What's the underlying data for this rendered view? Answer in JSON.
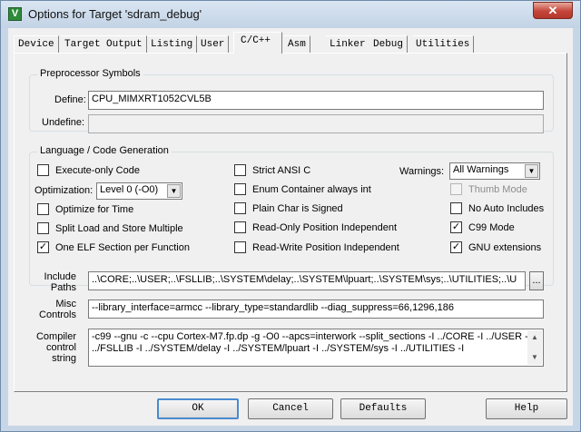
{
  "window": {
    "title": "Options for Target 'sdram_debug'",
    "close_glyph": "✕",
    "icon_letter": "V"
  },
  "tabs": [
    "Device",
    "Target",
    "Output",
    "Listing",
    "User",
    "C/C++",
    "Asm",
    "Linker",
    "Debug",
    "Utilities"
  ],
  "active_tab": "C/C++",
  "preprocessor": {
    "group_title": "Preprocessor Symbols",
    "define_label": "Define:",
    "define_value": "CPU_MIMXRT1052CVL5B",
    "undefine_label": "Undefine:",
    "undefine_value": ""
  },
  "language": {
    "group_title": "Language / Code Generation",
    "execute_only": {
      "label": "Execute-only Code",
      "checked": false
    },
    "optimization_label": "Optimization:",
    "optimization_value": "Level 0 (-O0)",
    "optimize_time": {
      "label": "Optimize for Time",
      "checked": false
    },
    "split_load": {
      "label": "Split Load and Store Multiple",
      "checked": false
    },
    "one_elf": {
      "label": "One ELF Section per Function",
      "checked": true
    },
    "strict_ansi": {
      "label": "Strict ANSI C",
      "checked": false
    },
    "enum_container": {
      "label": "Enum Container always int",
      "checked": false
    },
    "plain_char": {
      "label": "Plain Char is Signed",
      "checked": false
    },
    "ro_pi": {
      "label": "Read-Only Position Independent",
      "checked": false
    },
    "rw_pi": {
      "label": "Read-Write Position Independent",
      "checked": false
    },
    "warnings_label": "Warnings:",
    "warnings_value": "All Warnings",
    "thumb_mode": {
      "label": "Thumb Mode",
      "checked": false,
      "enabled": false
    },
    "no_auto_includes": {
      "label": "No Auto Includes",
      "checked": false
    },
    "c99_mode": {
      "label": "C99 Mode",
      "checked": true
    },
    "gnu_extensions": {
      "label": "GNU extensions",
      "checked": true
    }
  },
  "include": {
    "label_line1": "Include",
    "label_line2": "Paths",
    "value": "..\\CORE;..\\USER;..\\FSLLIB;..\\SYSTEM\\delay;..\\SYSTEM\\lpuart;..\\SYSTEM\\sys;..\\UTILITIES;..\\U",
    "browse_label": "..."
  },
  "misc": {
    "label_line1": "Misc",
    "label_line2": "Controls",
    "value": "--library_interface=armcc --library_type=standardlib --diag_suppress=66,1296,186"
  },
  "compiler": {
    "label_line1": "Compiler",
    "label_line2": "control",
    "label_line3": "string",
    "line1": "-c99 --gnu -c --cpu Cortex-M7.fp.dp -g -O0 --apcs=interwork --split_sections -I ../CORE -I ../USER -I",
    "line2": "../FSLLIB -I ../SYSTEM/delay -I ../SYSTEM/lpuart -I ../SYSTEM/sys -I ../UTILITIES -I"
  },
  "buttons": {
    "ok": "OK",
    "cancel": "Cancel",
    "defaults": "Defaults",
    "help": "Help"
  },
  "glyphs": {
    "check": "✓",
    "down": "▼",
    "up": "▲"
  }
}
